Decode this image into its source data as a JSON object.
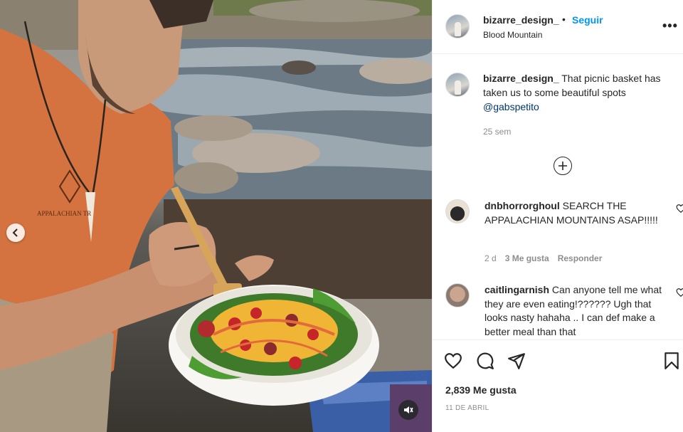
{
  "post": {
    "username": "bizarre_design_",
    "separator": "•",
    "follow_label": "Seguir",
    "location": "Blood Mountain",
    "more_label": "•••"
  },
  "caption": {
    "username": "bizarre_design_",
    "text": "That picnic basket has taken us to some beautiful spots",
    "mention": "@gabspetito",
    "time": "25 sem"
  },
  "comments": [
    {
      "username": "dnbhorrorghoul",
      "text": "SEARCH THE APPALACHIAN MOUNTAINS ASAP!!!!!",
      "time": "2 d",
      "likes": "3 Me gusta",
      "reply": "Responder"
    },
    {
      "username": "caitlingarnish",
      "text": "Can anyone tell me what they are even eating!?????? Ugh that looks nasty hahaha .. I can def make a better meal than that"
    }
  ],
  "likes_count": "2,839 Me gusta",
  "post_date": "11 DE ABRIL",
  "shirt_text": "APPALACHIAN TR",
  "icons": [
    "chevron-left-icon",
    "mute-icon",
    "more-icon",
    "plus-circle-icon",
    "heart-icon",
    "comment-icon",
    "share-icon",
    "bookmark-icon"
  ],
  "colors": {
    "accent": "#0095f6",
    "text": "#262626",
    "muted": "#8e8e8e",
    "mention": "#00376b",
    "shirt": "#d4733f"
  }
}
